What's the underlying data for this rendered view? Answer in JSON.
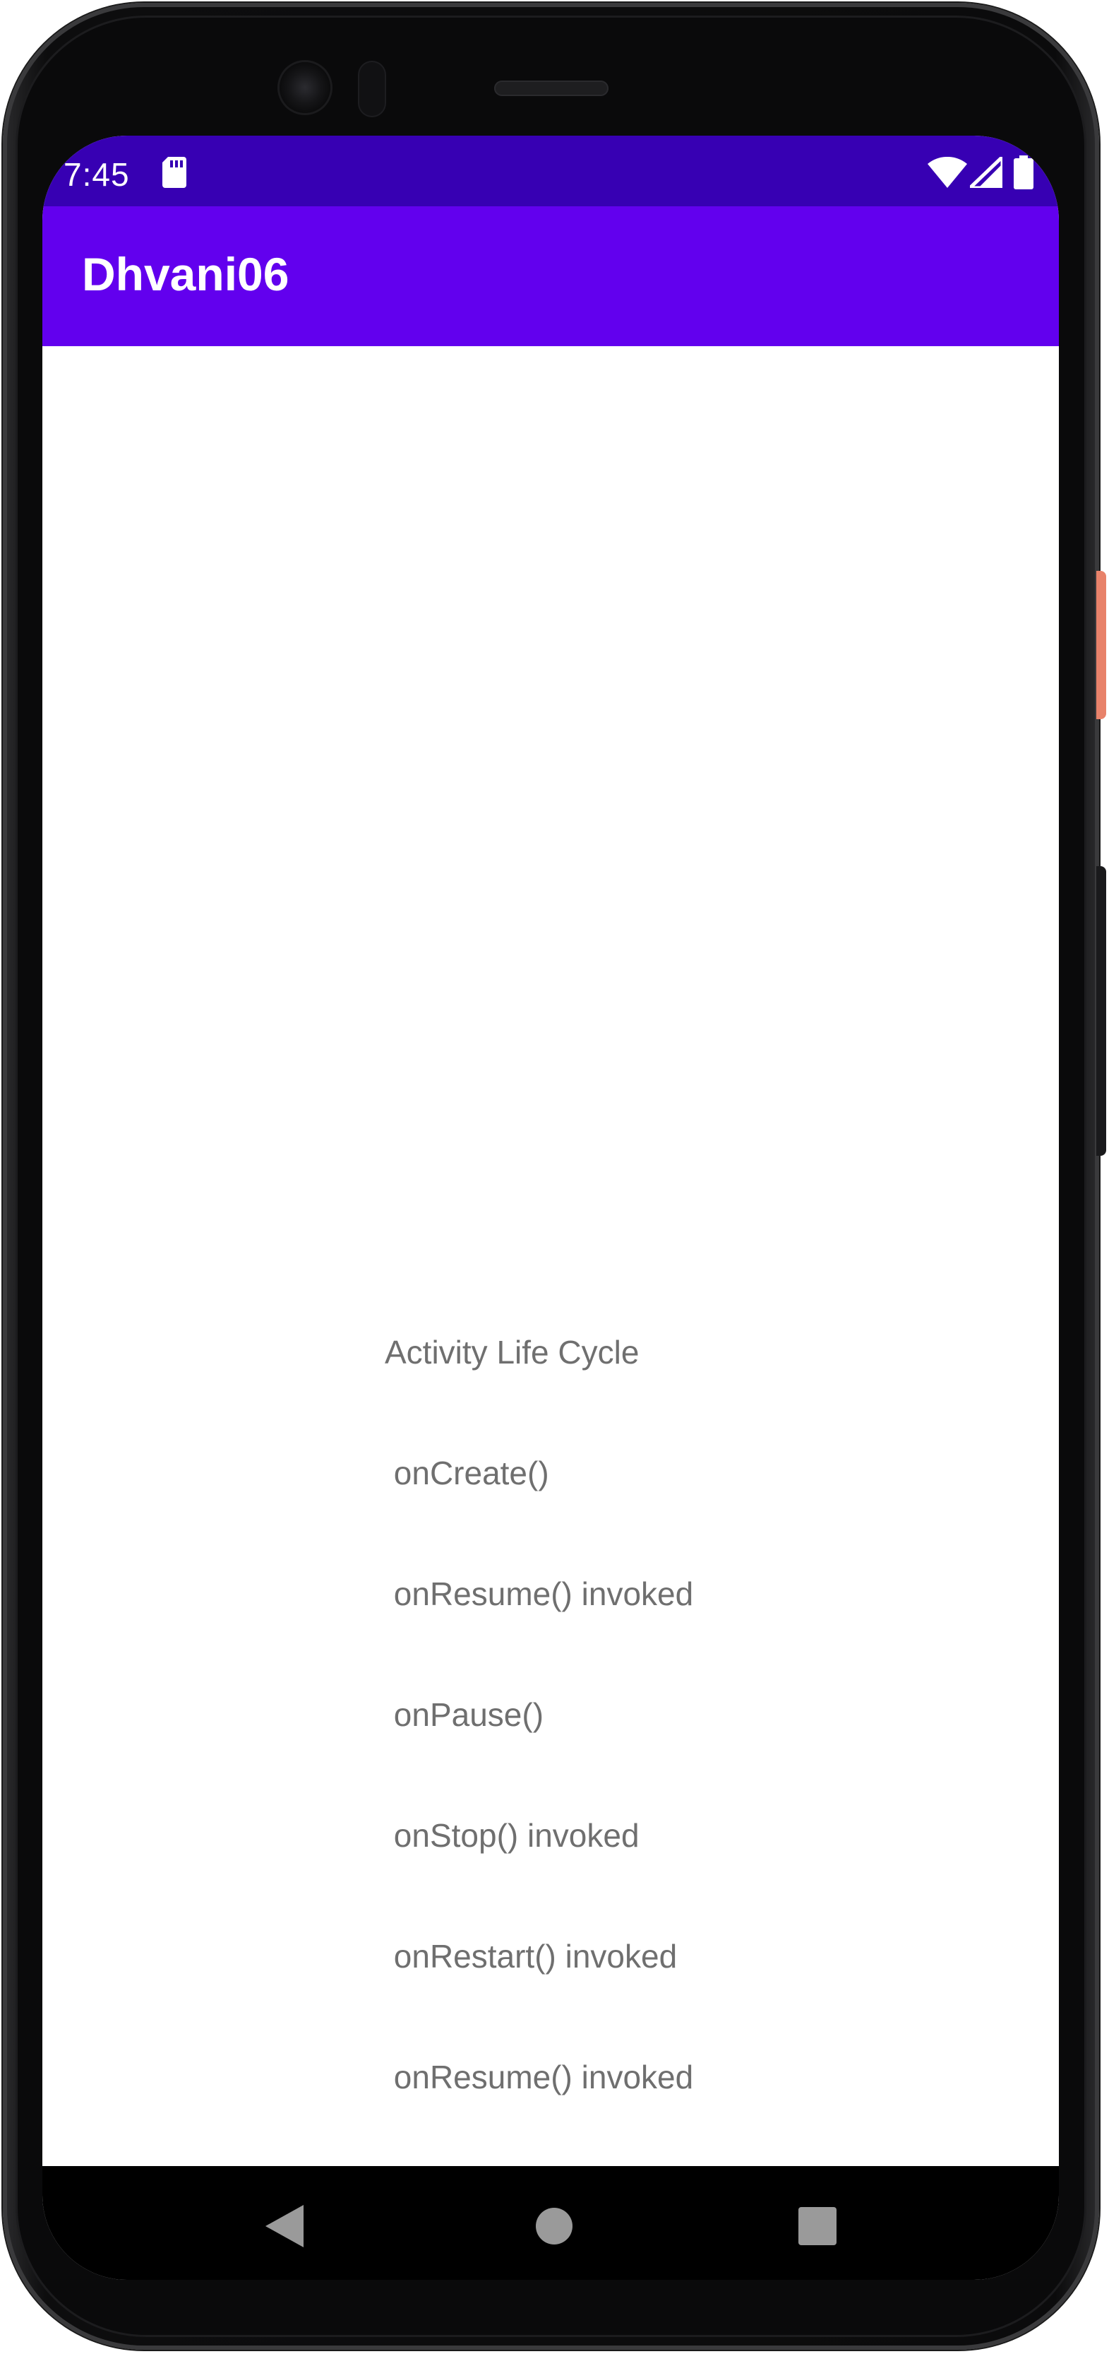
{
  "status_bar": {
    "time": "7:45",
    "icons": [
      "sd-card-icon",
      "wifi-icon",
      "signal-icon",
      "battery-icon"
    ]
  },
  "app_bar": {
    "title": "Dhvani06",
    "color": "#6200ee",
    "status_color": "#3700b3"
  },
  "content": {
    "lines": [
      "Activity Life Cycle",
      " onCreate()",
      " onResume() invoked",
      " onPause()",
      " onStop() invoked",
      " onRestart() invoked",
      " onResume() invoked"
    ],
    "text_color": "#6f6f6f"
  },
  "nav_bar": {
    "buttons": [
      "back-icon",
      "home-icon",
      "recents-icon"
    ]
  }
}
